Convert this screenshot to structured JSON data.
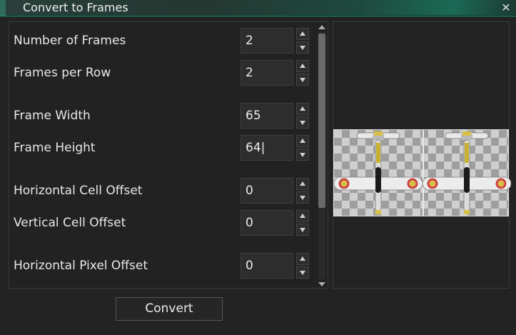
{
  "window": {
    "title": "Convert to Frames",
    "close_glyph": "✕"
  },
  "fields": [
    {
      "label": "Number of Frames",
      "value": "2"
    },
    {
      "label": "Frames per Row",
      "value": "2"
    },
    {
      "label": "Frame Width",
      "value": "65"
    },
    {
      "label": "Frame Height",
      "value": "64|"
    },
    {
      "label": "Horizontal Cell Offset",
      "value": "0"
    },
    {
      "label": "Vertical Cell Offset",
      "value": "0"
    },
    {
      "label": "Horizontal Pixel Offset",
      "value": "0"
    }
  ],
  "actions": {
    "convert_label": "Convert"
  },
  "icons": {
    "close": "close-icon",
    "spin_up": "chevron-up-icon",
    "spin_down": "chevron-down-icon"
  },
  "colors": {
    "accent": "#1f9a7a"
  }
}
